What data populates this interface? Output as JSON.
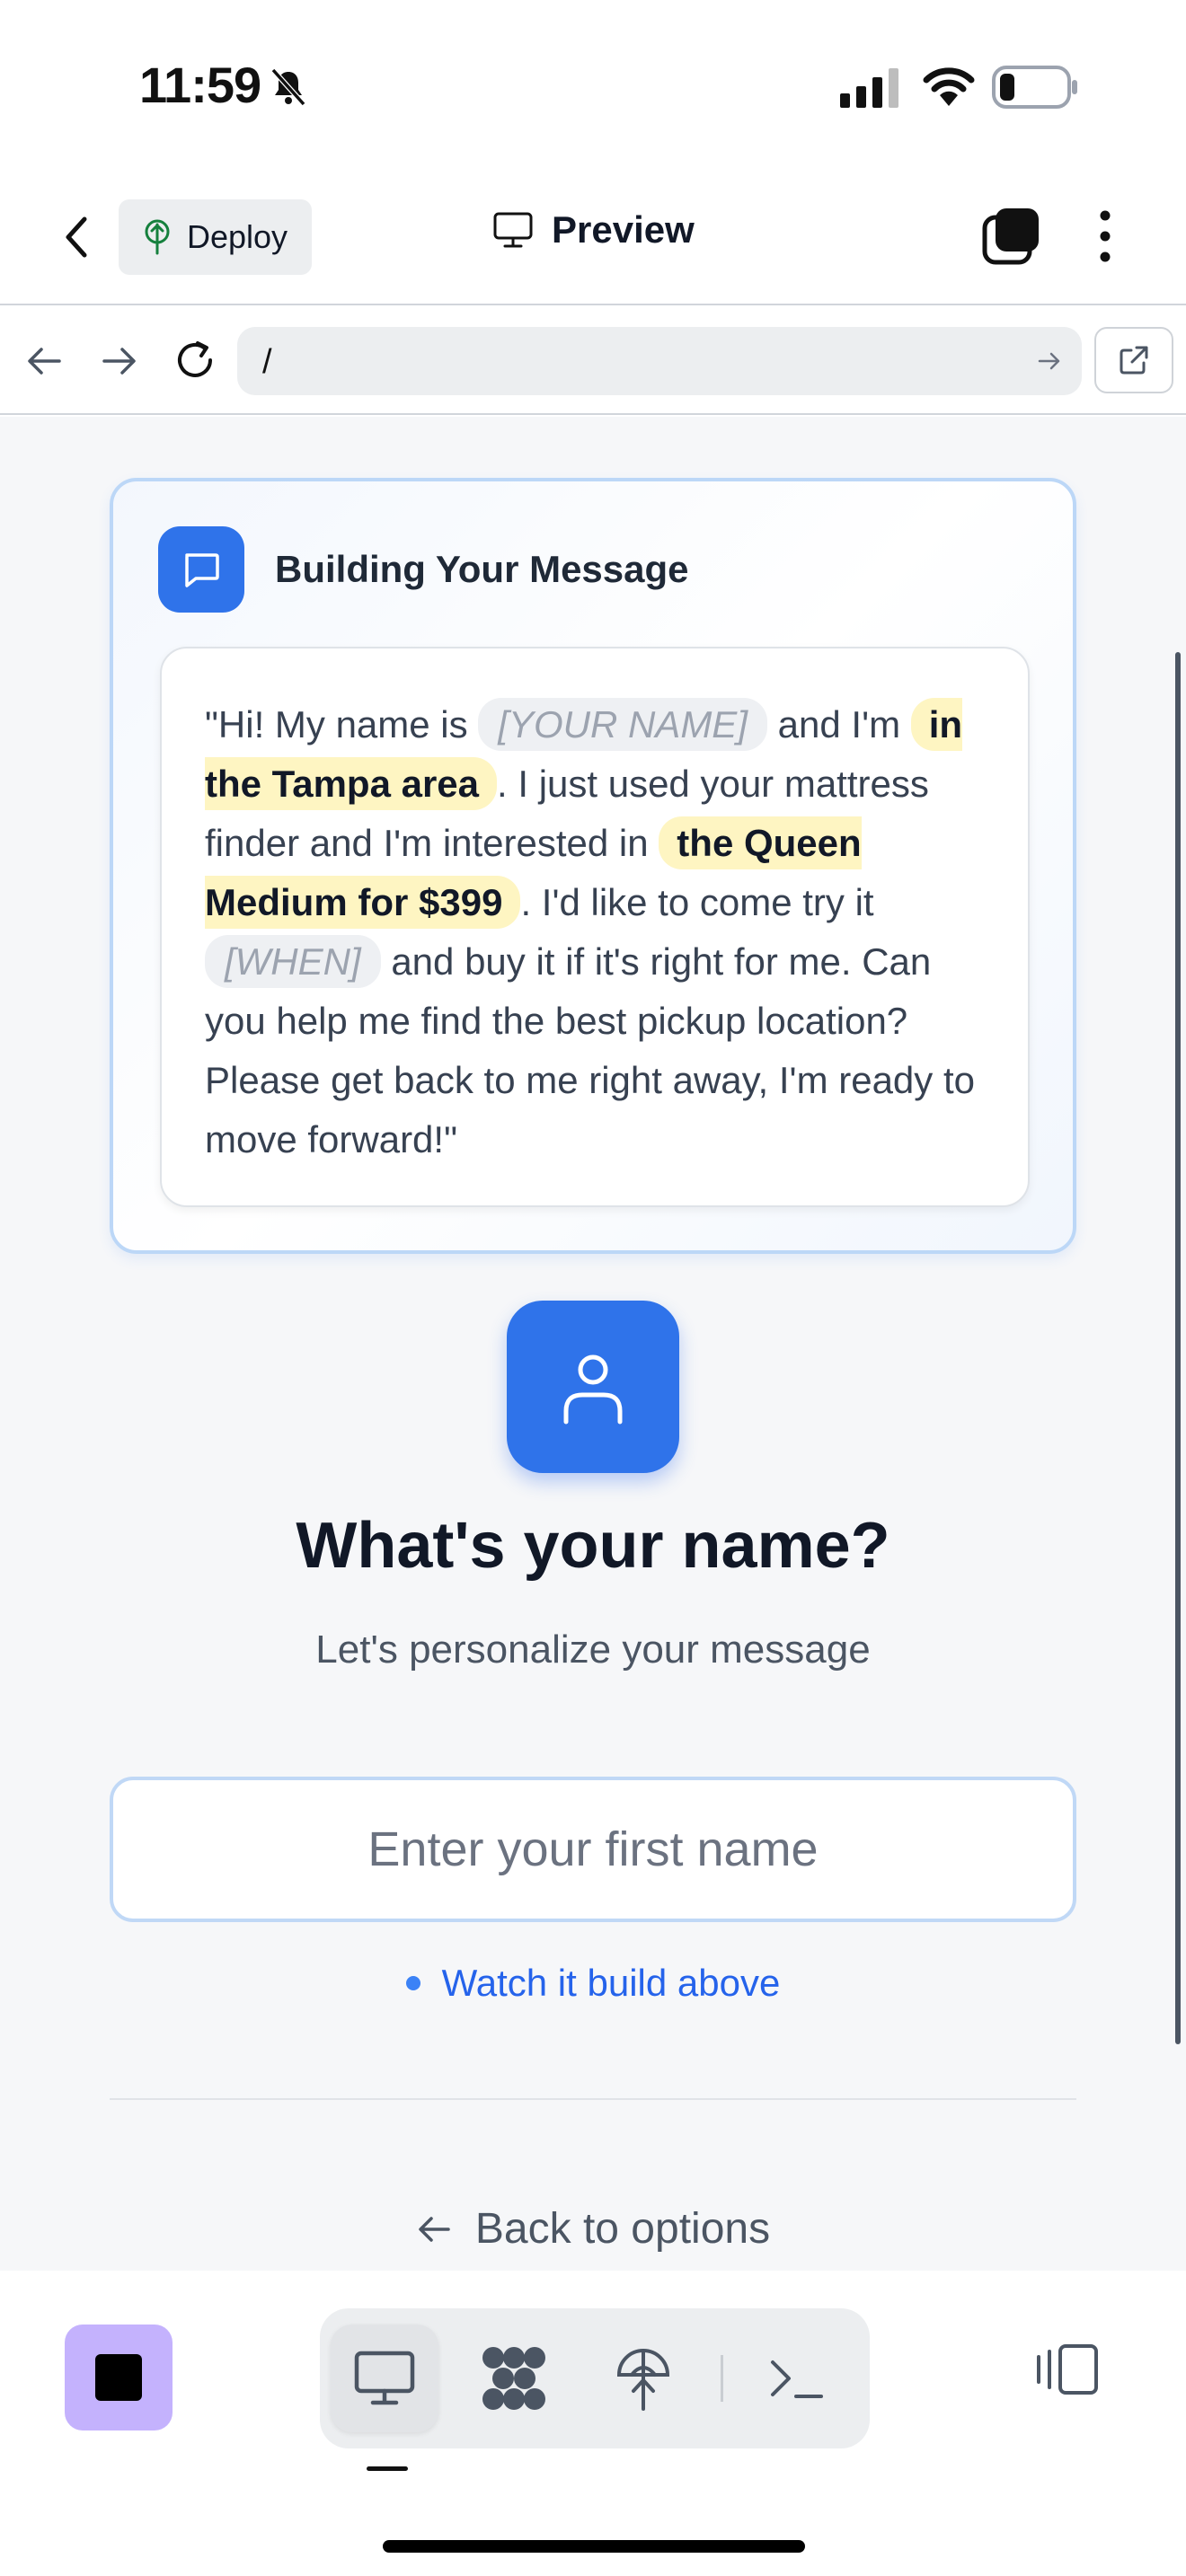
{
  "status_bar": {
    "time": "11:59"
  },
  "header": {
    "deploy_label": "Deploy",
    "preview_label": "Preview"
  },
  "browser": {
    "url": "/"
  },
  "card": {
    "title": "Building Your Message",
    "message": {
      "p1": "\"Hi! My name is ",
      "name_placeholder": "[YOUR NAME]",
      "p2": " and I'm ",
      "area_highlight": "in the Tampa area",
      "p3": ". I just used your mattress finder and I'm interested in ",
      "product_highlight": "the Queen Medium for $399",
      "p4": ". I'd like to come try it ",
      "when_placeholder": "[WHEN]",
      "p5": " and buy it if it's right for me. Can you help me find the best pickup location? Please get back to me right away, I'm ready to move forward!\""
    }
  },
  "question": {
    "title": "What's your name?",
    "subtitle": "Let's personalize your message",
    "input_placeholder": "Enter your first name",
    "input_value": "",
    "hint": "Watch it build above"
  },
  "footer": {
    "back_label": "Back to options"
  },
  "colors": {
    "accent": "#2f73ea",
    "highlight": "#fef5c2",
    "stop_button": "#c4b2fd"
  }
}
